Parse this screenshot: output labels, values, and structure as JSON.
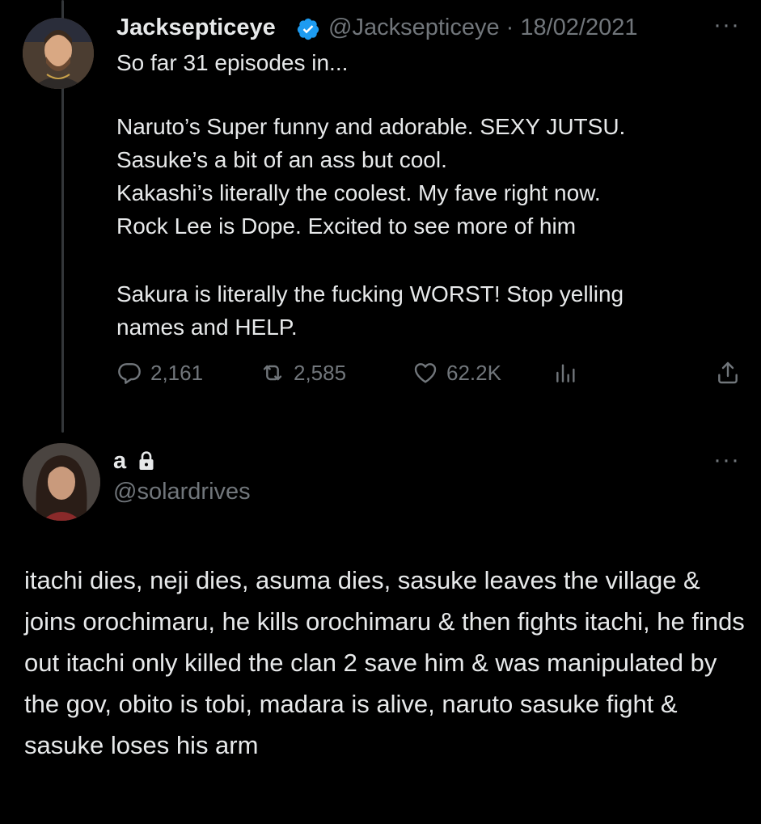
{
  "tweet": {
    "author_name": "Jacksepticeye",
    "handle_date": "@Jacksepticeye · 18/02/2021",
    "more_label": "···",
    "text_intro": "So far 31 episodes in...",
    "text_body": "Naruto’s Super funny and adorable. SEXY JUTSU.\nSasuke’s a bit of an ass but cool.\nKakashi’s literally the coolest. My fave right now.\nRock Lee is Dope. Excited to see more of him",
    "text_end": "Sakura is literally the fucking WORST! Stop yelling\nnames and HELP.",
    "replies": "2,161",
    "retweets": "2,585",
    "likes": "62.2K",
    "avatar_icon": "user-avatar-icon",
    "verified_icon": "verified-badge-icon"
  },
  "reply": {
    "author_name": "a",
    "handle": "@solardrives",
    "more_label": "···",
    "text": "itachi dies, neji dies, asuma dies, sasuke leaves the village & joins orochimaru, he kills orochimaru & then fights itachi, he finds out itachi only killed the clan 2 save him & was manipulated by the gov, obito is tobi, madara is alive, naruto sasuke fight & sasuke loses his arm",
    "lock_icon": "lock-icon"
  },
  "colors": {
    "background": "#000000",
    "text": "#e7e9ea",
    "muted": "#71767b",
    "verified": "#1d9bf0"
  }
}
